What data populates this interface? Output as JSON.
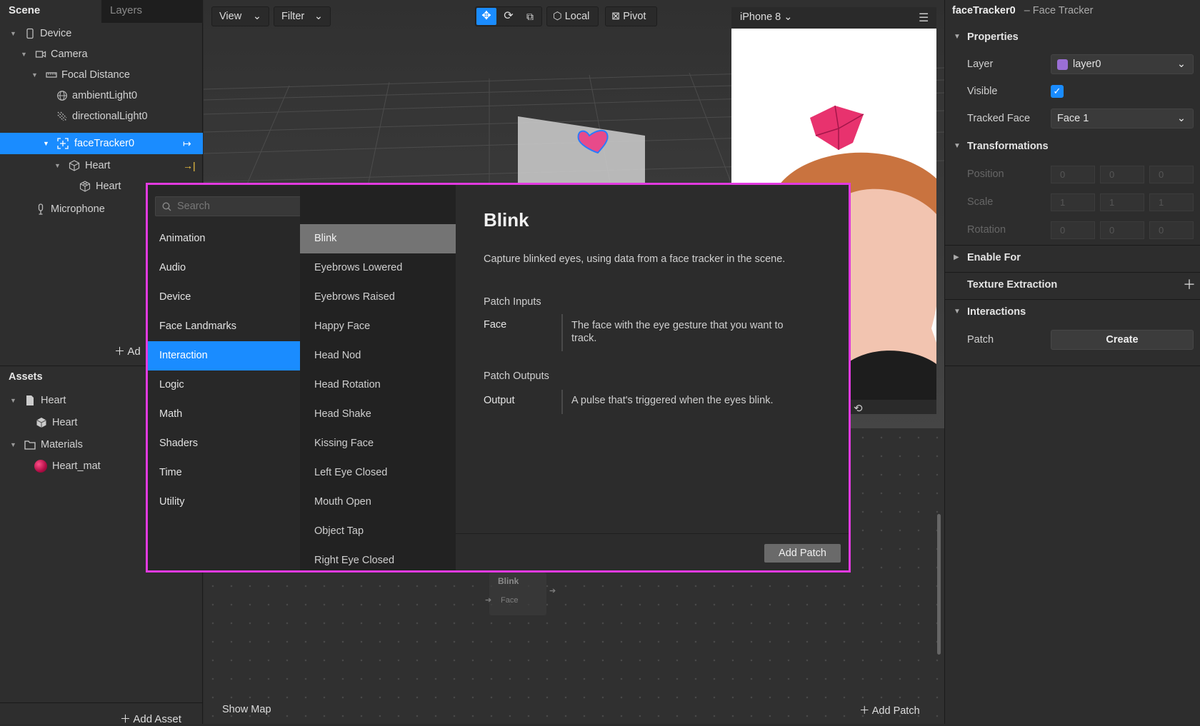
{
  "left": {
    "tabs": {
      "scene": "Scene",
      "layers": "Layers"
    },
    "tree": [
      {
        "label": "Device"
      },
      {
        "label": "Camera"
      },
      {
        "label": "Focal Distance"
      },
      {
        "label": "ambientLight0"
      },
      {
        "label": "directionalLight0"
      },
      {
        "label": "faceTracker0"
      },
      {
        "label": "Heart"
      },
      {
        "label": "Heart"
      },
      {
        "label": "Microphone"
      }
    ],
    "add_object": "Ad",
    "assets_title": "Assets",
    "assets": [
      {
        "label": "Heart"
      },
      {
        "label": "Heart"
      },
      {
        "label": "Materials"
      },
      {
        "label": "Heart_mat"
      }
    ],
    "add_asset": "Add Asset"
  },
  "viewport": {
    "view": "View",
    "filter": "Filter",
    "local": "Local",
    "pivot": "Pivot",
    "device": "iPhone 8"
  },
  "patch_editor": {
    "node_title": "Blink",
    "node_port": "Face",
    "show_map": "Show Map",
    "add_patch": "Add Patch"
  },
  "right": {
    "object_name": "faceTracker0",
    "object_type": "– Face Tracker",
    "properties": "Properties",
    "layer_label": "Layer",
    "layer_value": "layer0",
    "layer_color": "#9b6fd6",
    "visible_label": "Visible",
    "visible": true,
    "tracked_face_label": "Tracked Face",
    "tracked_face_value": "Face 1",
    "transformations": "Transformations",
    "position_label": "Position",
    "position": [
      "0",
      "0",
      "0"
    ],
    "scale_label": "Scale",
    "scale": [
      "1",
      "1",
      "1"
    ],
    "rotation_label": "Rotation",
    "rotation": [
      "0",
      "0",
      "0"
    ],
    "enable_for": "Enable For",
    "texture_extraction": "Texture Extraction",
    "interactions": "Interactions",
    "patch_label": "Patch",
    "create": "Create"
  },
  "dialog": {
    "search_placeholder": "Search",
    "categories": [
      "Animation",
      "Audio",
      "Device",
      "Face Landmarks",
      "Interaction",
      "Logic",
      "Math",
      "Shaders",
      "Time",
      "Utility"
    ],
    "selected_category": "Interaction",
    "items": [
      "Blink",
      "Eyebrows Lowered",
      "Eyebrows Raised",
      "Happy Face",
      "Head Nod",
      "Head Rotation",
      "Head Shake",
      "Kissing Face",
      "Left Eye Closed",
      "Mouth Open",
      "Object Tap",
      "Right Eye Closed"
    ],
    "selected_item": "Blink",
    "detail": {
      "title": "Blink",
      "description": "Capture blinked eyes, using data from a face tracker in the scene.",
      "inputs_title": "Patch Inputs",
      "input_name": "Face",
      "input_desc": "The face with the eye gesture that you want to track.",
      "outputs_title": "Patch Outputs",
      "output_name": "Output",
      "output_desc": "A pulse that's triggered when the eyes blink."
    },
    "add_patch": "Add Patch"
  },
  "colors": {
    "accent": "#1a8cff",
    "highlight_border": "#e23ae0"
  }
}
